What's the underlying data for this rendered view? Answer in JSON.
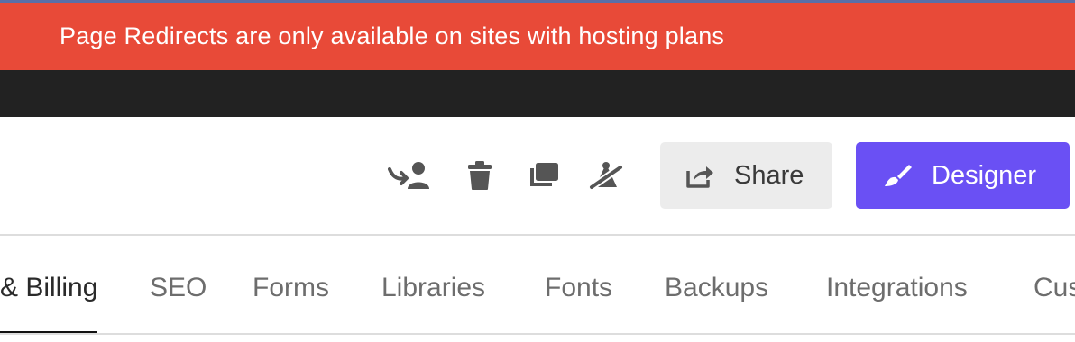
{
  "banner": {
    "message": "Page Redirects are only available on sites with hosting plans"
  },
  "toolbar": {
    "icons": [
      "transfer-user-icon",
      "trash-icon",
      "duplicate-icon",
      "unpublish-icon"
    ],
    "share_label": "Share",
    "designer_label": "Designer"
  },
  "tabs": [
    {
      "label": "& Billing",
      "active": true
    },
    {
      "label": "SEO",
      "active": false
    },
    {
      "label": "Forms",
      "active": false
    },
    {
      "label": "Libraries",
      "active": false
    },
    {
      "label": "Fonts",
      "active": false
    },
    {
      "label": "Backups",
      "active": false
    },
    {
      "label": "Integrations",
      "active": false
    },
    {
      "label": "Cus",
      "active": false
    }
  ],
  "colors": {
    "banner": "#e84a38",
    "designer": "#6a50f4",
    "share": "#ececec"
  }
}
